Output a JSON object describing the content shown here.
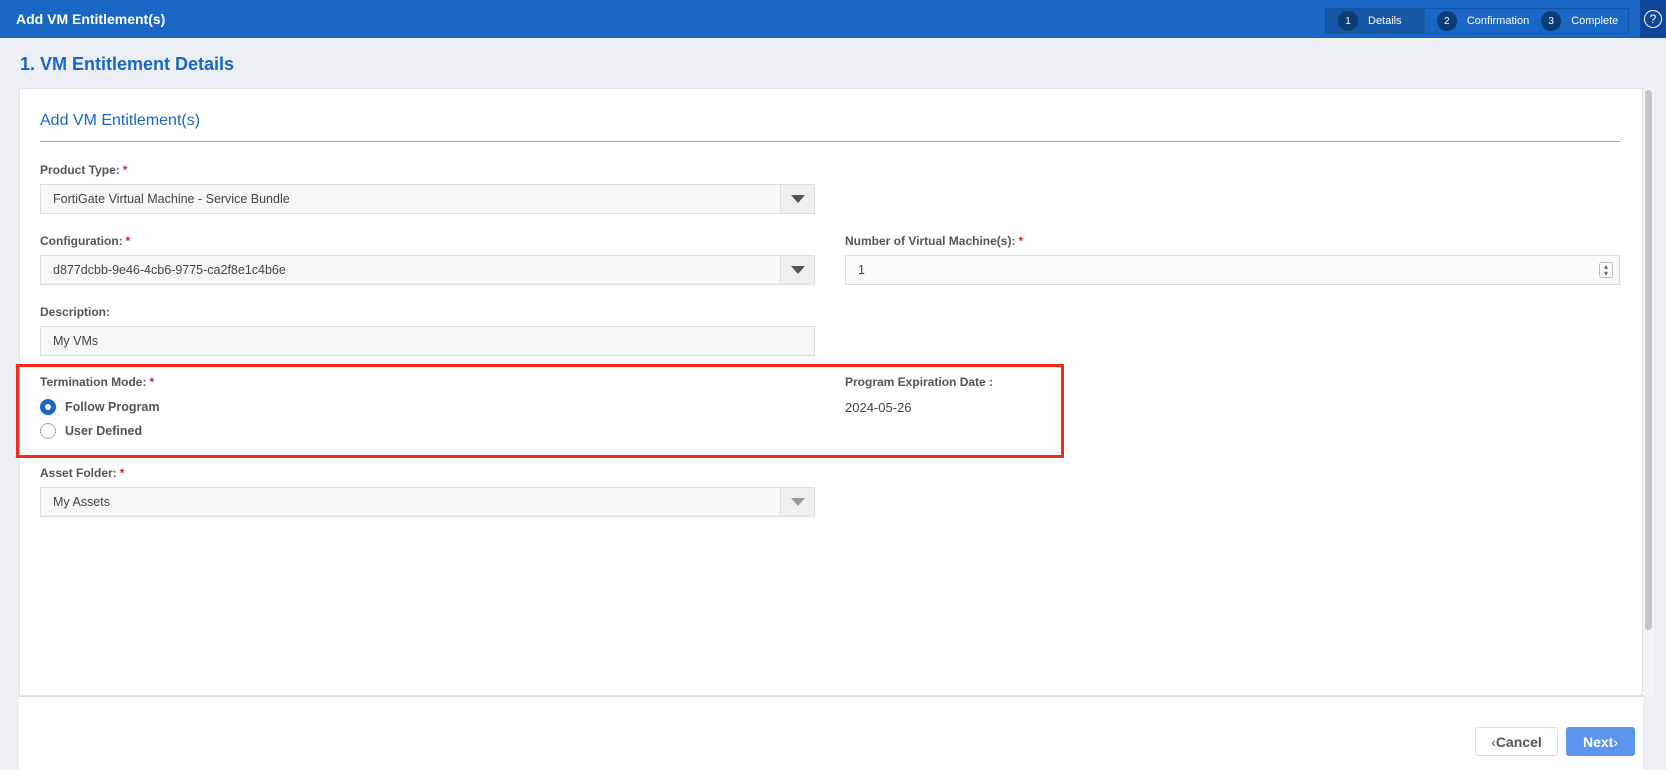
{
  "header": {
    "title": "Add VM Entitlement(s)",
    "help_icon": "question-circle-icon",
    "steps": [
      {
        "num": "1",
        "label": "Details",
        "active": true
      },
      {
        "num": "2",
        "label": "Confirmation"
      },
      {
        "num": "3",
        "label": "Complete"
      }
    ]
  },
  "page_title": "1. VM Entitlement Details",
  "form": {
    "heading": "Add VM Entitlement(s)",
    "product_type": {
      "label": "Product Type:",
      "required": "*",
      "value": "FortiGate Virtual Machine - Service Bundle"
    },
    "configuration": {
      "label": "Configuration:",
      "required": "*",
      "value": "d877dcbb-9e46-4cb6-9775-ca2f8e1c4b6e"
    },
    "num_vms": {
      "label": "Number of Virtual Machine(s):",
      "required": "*",
      "value": "1"
    },
    "description": {
      "label": "Description:",
      "value": "My VMs"
    },
    "termination": {
      "label": "Termination Mode:",
      "required": "*",
      "options": [
        {
          "label": "Follow Program",
          "selected": true
        },
        {
          "label": "User Defined",
          "selected": false
        }
      ]
    },
    "expiration": {
      "label": "Program Expiration Date :",
      "value": "2024-05-26"
    },
    "asset_folder": {
      "label": "Asset Folder:",
      "required": "*",
      "value": "My Assets"
    }
  },
  "footer": {
    "cancel": "Cancel",
    "next": "Next"
  },
  "colors": {
    "brand": "#1a66c4",
    "highlight": "#f52a1a",
    "next_button": "#5b95ed"
  }
}
